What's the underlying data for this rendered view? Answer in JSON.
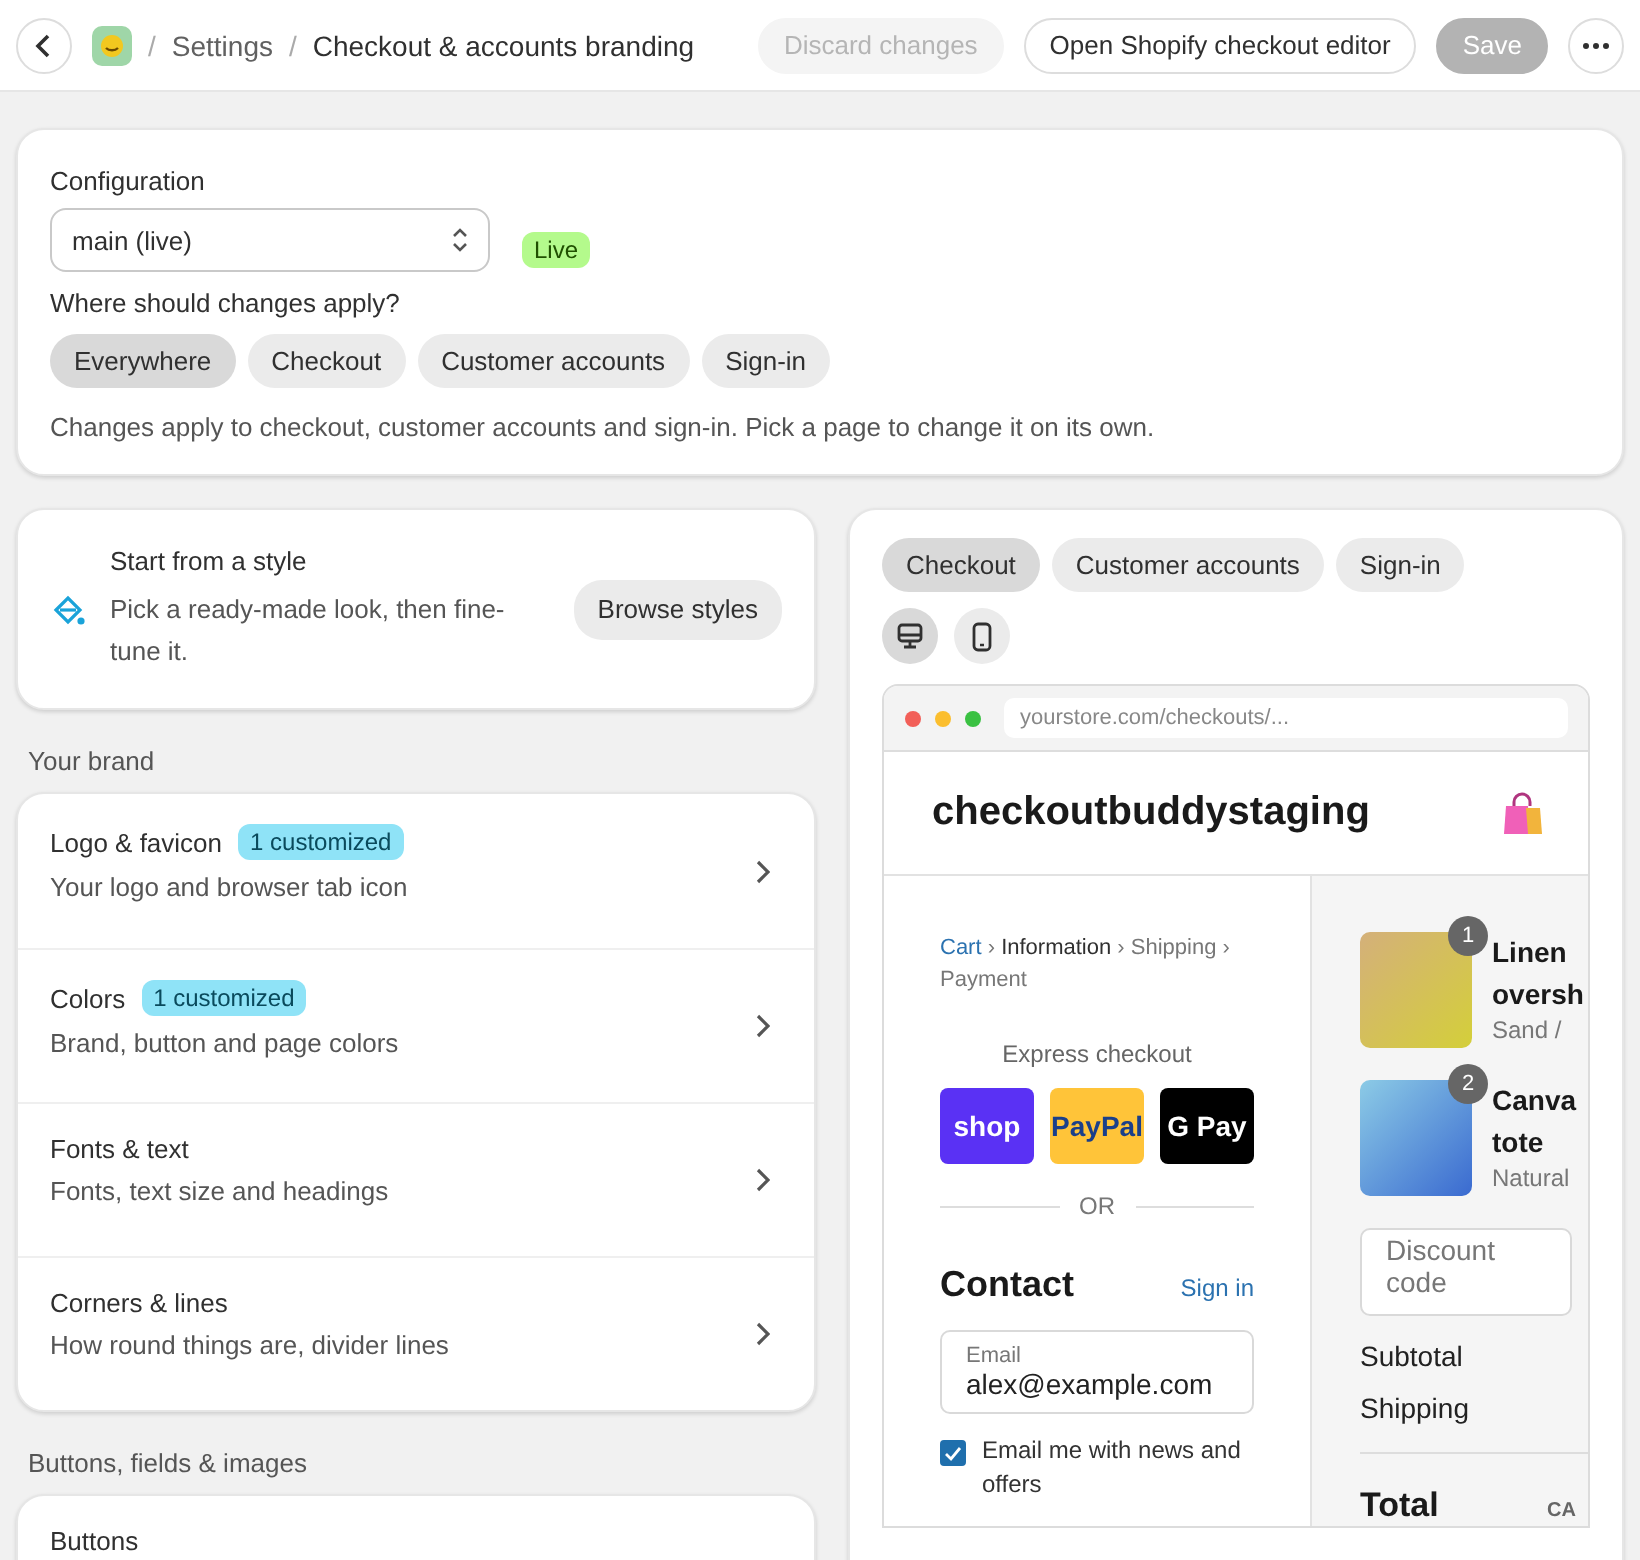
{
  "top_bar": {
    "breadcrumb": [
      {
        "label": "Settings",
        "current": false
      },
      {
        "label": "Checkout & accounts branding",
        "current": true
      }
    ],
    "separator": "/",
    "buttons": [
      {
        "label": "Discard changes",
        "kind": "secondary",
        "disabled": true
      },
      {
        "label": "Open Shopify checkout editor",
        "kind": "secondary",
        "disabled": false
      },
      {
        "label": "Save",
        "kind": "primary",
        "disabled": true
      }
    ]
  },
  "configuration": {
    "label": "Configuration",
    "select_value": "main (live)",
    "status_badge": "Live",
    "scope_label": "Where should changes apply?",
    "scope_tabs": [
      {
        "label": "Everywhere",
        "selected": true
      },
      {
        "label": "Checkout",
        "selected": false
      },
      {
        "label": "Customer accounts",
        "selected": false
      },
      {
        "label": "Sign-in",
        "selected": false
      }
    ],
    "help_text": "Changes apply to checkout, customer accounts and sign-in. Pick a page to change it on its own."
  },
  "style_card": {
    "title": "Start from a style",
    "description": "Pick a ready-made look, then fine-tune it.",
    "button": "Browse styles"
  },
  "sections": [
    {
      "heading": "Your brand",
      "items": [
        {
          "title": "Logo & favicon",
          "badge": "1 customized",
          "description": "Your logo and browser tab icon"
        },
        {
          "title": "Colors",
          "badge": "1 customized",
          "description": "Brand, button and page colors"
        },
        {
          "title": "Fonts & text",
          "description": "Fonts, text size and headings"
        },
        {
          "title": "Corners & lines",
          "description": "How round things are, divider lines"
        }
      ]
    },
    {
      "heading": "Buttons, fields & images",
      "items": [
        {
          "title": "Buttons"
        }
      ]
    }
  ],
  "preview": {
    "tabs": [
      {
        "label": "Checkout",
        "selected": true
      },
      {
        "label": "Customer accounts",
        "selected": false
      },
      {
        "label": "Sign-in",
        "selected": false
      }
    ],
    "devices": [
      {
        "kind": "desktop",
        "selected": true
      },
      {
        "kind": "mobile",
        "selected": false
      }
    ],
    "url": "yourstore.com/checkouts/...",
    "store_name": "checkoutbuddystaging",
    "crumb_separator": "›",
    "breadcrumb": [
      {
        "label": "Cart",
        "kind": "link"
      },
      {
        "label": "Information",
        "kind": "current"
      },
      {
        "label": "Shipping",
        "kind": "upcoming"
      },
      {
        "label": "Payment",
        "kind": "upcoming"
      }
    ],
    "express_label": "Express checkout",
    "pay_buttons": [
      {
        "kind": "shop",
        "label": "shop"
      },
      {
        "kind": "paypal",
        "label": "PayPal"
      },
      {
        "kind": "gpay",
        "label": "G Pay"
      }
    ],
    "divider_text": "OR",
    "contact_heading": "Contact",
    "sign_in": "Sign in",
    "email_label": "Email",
    "email_value": "alex@example.com",
    "newsletter": {
      "label": "Email me with news and offers",
      "checked": true
    },
    "products": [
      {
        "name": "Linen oversh",
        "variant": "Sand /",
        "quantity": "1"
      },
      {
        "name": "Canva tote",
        "variant": "Natural",
        "quantity": "2"
      }
    ],
    "discount_placeholder": "Discount code",
    "summary": [
      "Subtotal",
      "Shipping"
    ],
    "total_label": "Total",
    "currency": "CA"
  }
}
